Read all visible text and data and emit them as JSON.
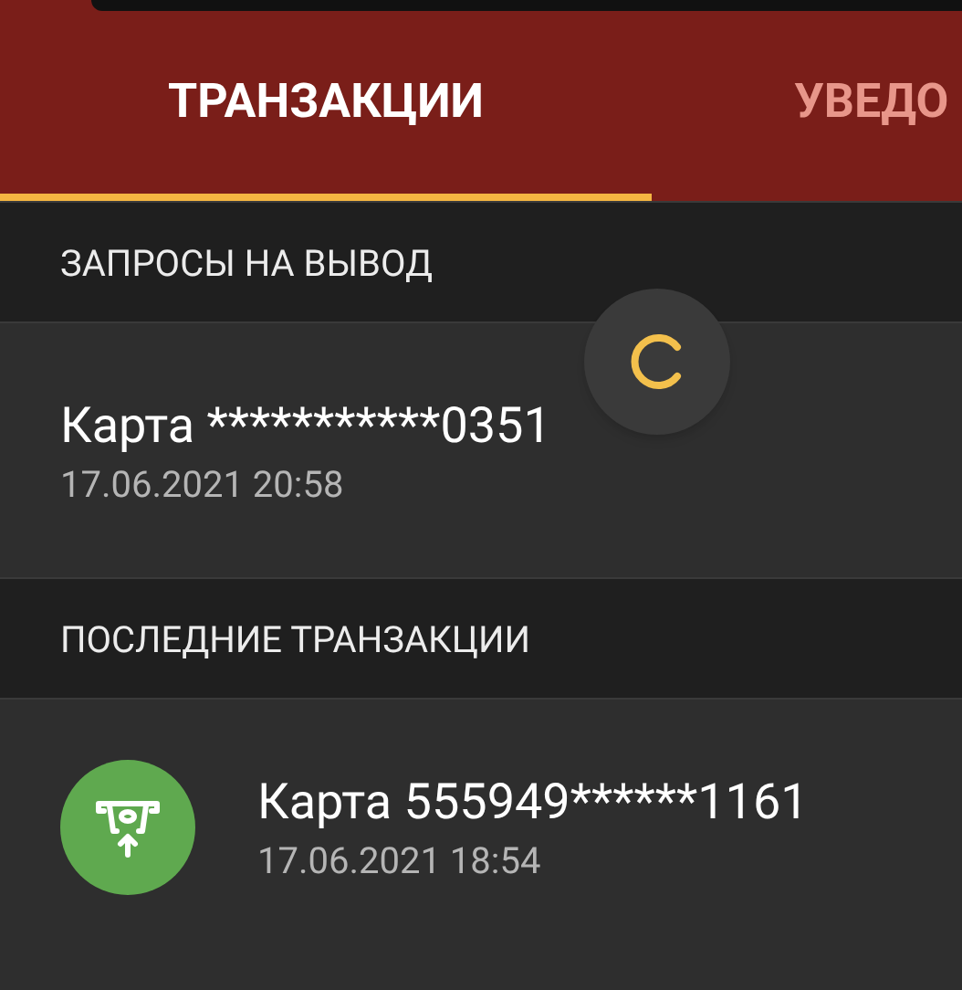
{
  "tabs": [
    {
      "label": "ТРАНЗАКЦИИ",
      "selected": true
    },
    {
      "label": "УВЕДО",
      "selected": false
    }
  ],
  "withdrawal_requests": {
    "title": "ЗАПРОСЫ НА ВЫВОД",
    "items": [
      {
        "title": "Карта ***********0351",
        "date": "17.06.2021 20:58"
      }
    ]
  },
  "recent_transactions": {
    "title": "ПОСЛЕДНИЕ ТРАНЗАКЦИИ",
    "items": [
      {
        "kind": "withdrawal",
        "title": "Карта 555949******1161",
        "date": "17.06.2021 18:54"
      }
    ]
  }
}
